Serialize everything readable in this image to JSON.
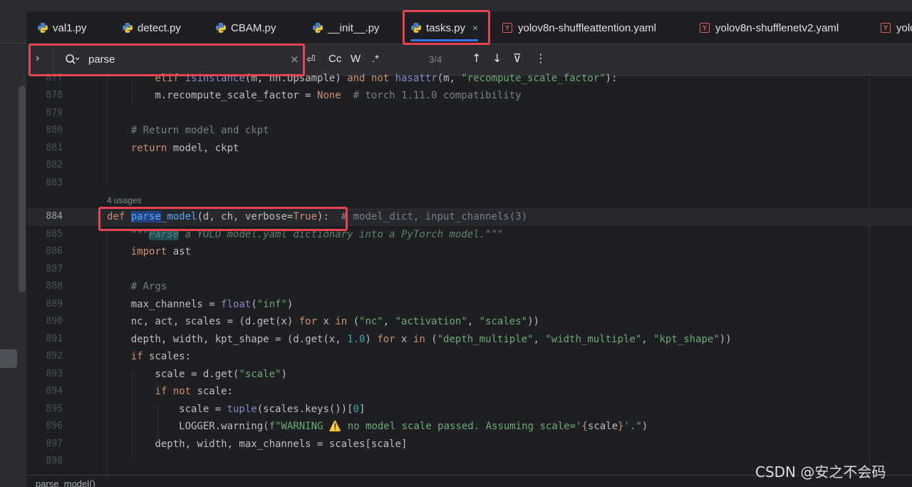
{
  "tabs": [
    {
      "label": "val1.py",
      "icon": "python-icon"
    },
    {
      "label": "detect.py",
      "icon": "python-icon"
    },
    {
      "label": "CBAM.py",
      "icon": "python-icon"
    },
    {
      "label": "__init__.py",
      "icon": "python-icon"
    },
    {
      "label": "tasks.py",
      "icon": "python-icon",
      "active": true,
      "close": "×"
    },
    {
      "label": "yolov8n-shuffleattention.yaml",
      "icon": "yaml-icon"
    },
    {
      "label": "yolov8n-shufflenetv2.yaml",
      "icon": "yaml-icon"
    },
    {
      "label": "yolo",
      "icon": "yaml-icon"
    }
  ],
  "yaml_glyph": "Y",
  "search": {
    "expand": "›",
    "value": "parse",
    "clear": "×",
    "opt_regex_newline": "⏎",
    "opt_case": "Cc",
    "opt_words": "W",
    "opt_regex": ".*",
    "match_count": "3/4",
    "prev": "↑",
    "next": "↓",
    "filter": "⊽",
    "more": "⋮"
  },
  "editor": {
    "usages_hint": "4 usages",
    "lines": [
      {
        "num": "877",
        "text": "        elif isinstance(m, nn.Upsample) and not hasattr(m, \"recompute_scale_factor\"):"
      },
      {
        "num": "878",
        "text": "            m.recompute_scale_factor = None  # torch 1.11.0 compatibility"
      },
      {
        "num": "879",
        "text": ""
      },
      {
        "num": "880",
        "text": "    # Return model and ckpt"
      },
      {
        "num": "881",
        "text": "    return model, ckpt"
      },
      {
        "num": "882",
        "text": ""
      },
      {
        "num": "883",
        "text": ""
      },
      {
        "num": "884",
        "text": "def parse_model(d, ch, verbose=True):  # model_dict, input_channels(3)"
      },
      {
        "num": "885",
        "text": "    \"\"\"Parse a YOLO model.yaml dictionary into a PyTorch model.\"\"\""
      },
      {
        "num": "886",
        "text": "    import ast"
      },
      {
        "num": "887",
        "text": ""
      },
      {
        "num": "888",
        "text": "    # Args"
      },
      {
        "num": "889",
        "text": "    max_channels = float(\"inf\")"
      },
      {
        "num": "890",
        "text": "    nc, act, scales = (d.get(x) for x in (\"nc\", \"activation\", \"scales\"))"
      },
      {
        "num": "891",
        "text": "    depth, width, kpt_shape = (d.get(x, 1.0) for x in (\"depth_multiple\", \"width_multiple\", \"kpt_shape\"))"
      },
      {
        "num": "892",
        "text": "    if scales:"
      },
      {
        "num": "893",
        "text": "        scale = d.get(\"scale\")"
      },
      {
        "num": "894",
        "text": "        if not scale:"
      },
      {
        "num": "895",
        "text": "            scale = tuple(scales.keys())[0]"
      },
      {
        "num": "896",
        "text": "            LOGGER.warning(f\"WARNING ⚠️ no model scale passed. Assuming scale='{scale}'.\")"
      },
      {
        "num": "897",
        "text": "        depth, width, max_channels = scales[scale]"
      },
      {
        "num": "898",
        "text": ""
      }
    ]
  },
  "breadcrumb": "parse_model()",
  "watermark": "CSDN @安之不会码",
  "colors": {
    "accent": "#3574f0",
    "annotation": "#e8434f",
    "keyword": "#cf8e6d",
    "string": "#6aab73",
    "comment": "#7a7e85",
    "number": "#2aacb8"
  }
}
